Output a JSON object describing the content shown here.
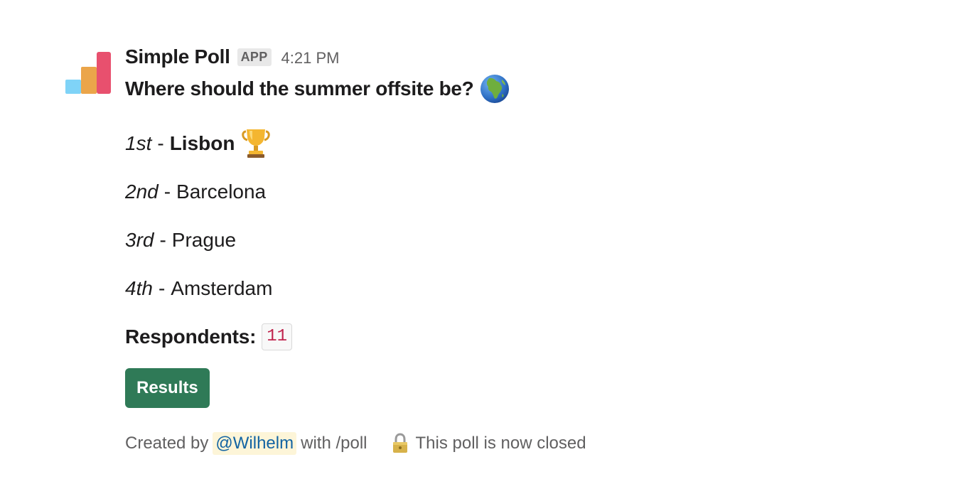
{
  "message": {
    "sender": "Simple Poll",
    "badge": "APP",
    "timestamp": "4:21 PM",
    "question": "Where should the summer offsite be?",
    "options": [
      {
        "rank": "1st",
        "sep": "-",
        "name": "Lisbon"
      },
      {
        "rank": "2nd",
        "sep": "-",
        "name": "Barcelona"
      },
      {
        "rank": "3rd",
        "sep": "-",
        "name": "Prague"
      },
      {
        "rank": "4th",
        "sep": "-",
        "name": "Amsterdam"
      }
    ],
    "respondents_label": "Respondents:",
    "respondents_count": "11",
    "results_button": "Results",
    "footer": {
      "created_by": "Created by",
      "mention": "@Wilhelm",
      "with_command": "with /poll",
      "closed_text": "This poll is now closed"
    }
  },
  "icons": {
    "avatar": "simple-poll-logo",
    "question_emoji": "globe-icon",
    "winner_emoji": "trophy-icon",
    "closed_emoji": "lock-icon"
  },
  "colors": {
    "button_bg": "#2f7a57",
    "mention_bg": "#fdf5d8",
    "mention_text": "#1264a3",
    "count_text": "#c0234d",
    "logo_blue": "#7fd3f7",
    "logo_orange": "#eba54a",
    "logo_pink": "#e8506e"
  }
}
